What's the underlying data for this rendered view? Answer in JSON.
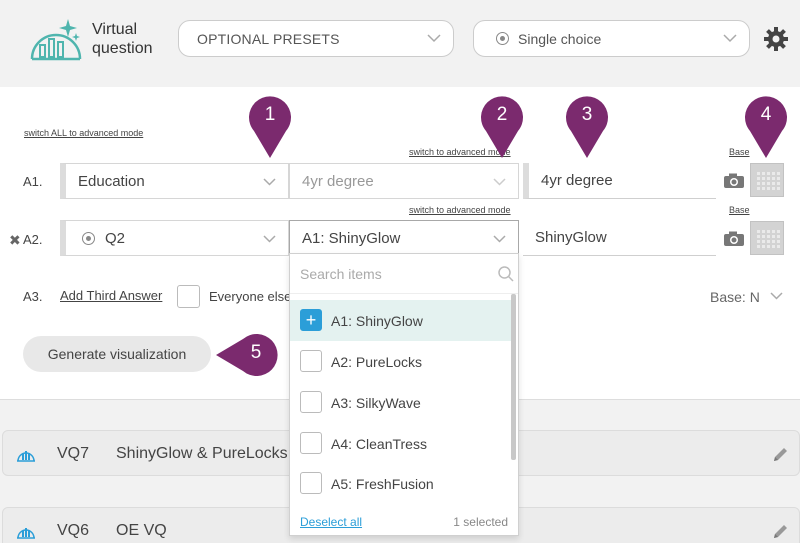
{
  "header": {
    "title": "Virtual question",
    "presets_label": "OPTIONAL PRESETS",
    "choice_label": "Single choice"
  },
  "panel": {
    "switch_all": "switch ALL to advanced mode",
    "switch_advanced": "switch to advanced mode",
    "base": "Base",
    "rows": [
      {
        "label": "A1.",
        "question": "Education",
        "answer": "4yr degree",
        "text": "4yr degree"
      },
      {
        "label": "A2.",
        "question": "Q2",
        "answer": "A1: ShinyGlow",
        "text": "ShinyGlow"
      }
    ],
    "a3_label": "A3.",
    "add_third": "Add Third Answer",
    "everyone_else": "Everyone else",
    "base_n": "Base: N",
    "generate": "Generate visualization"
  },
  "markers": [
    "1",
    "2",
    "3",
    "4",
    "5"
  ],
  "dropdown": {
    "search_placeholder": "Search items",
    "items": [
      {
        "label": "A1: ShinyGlow",
        "checked": true
      },
      {
        "label": "A2: PureLocks",
        "checked": false
      },
      {
        "label": "A3: SilkyWave",
        "checked": false
      },
      {
        "label": "A4: CleanTress",
        "checked": false
      },
      {
        "label": "A5: FreshFusion",
        "checked": false
      }
    ],
    "deselect_all": "Deselect all",
    "selected_count": "1 selected"
  },
  "vq_list": [
    {
      "id": "VQ7",
      "name": "ShinyGlow & PureLocks"
    },
    {
      "id": "VQ6",
      "name": "OE VQ"
    }
  ],
  "colors": {
    "marker": "#7b2a6e",
    "accent": "#2b9ed8",
    "logo": "#4fb5ae"
  }
}
